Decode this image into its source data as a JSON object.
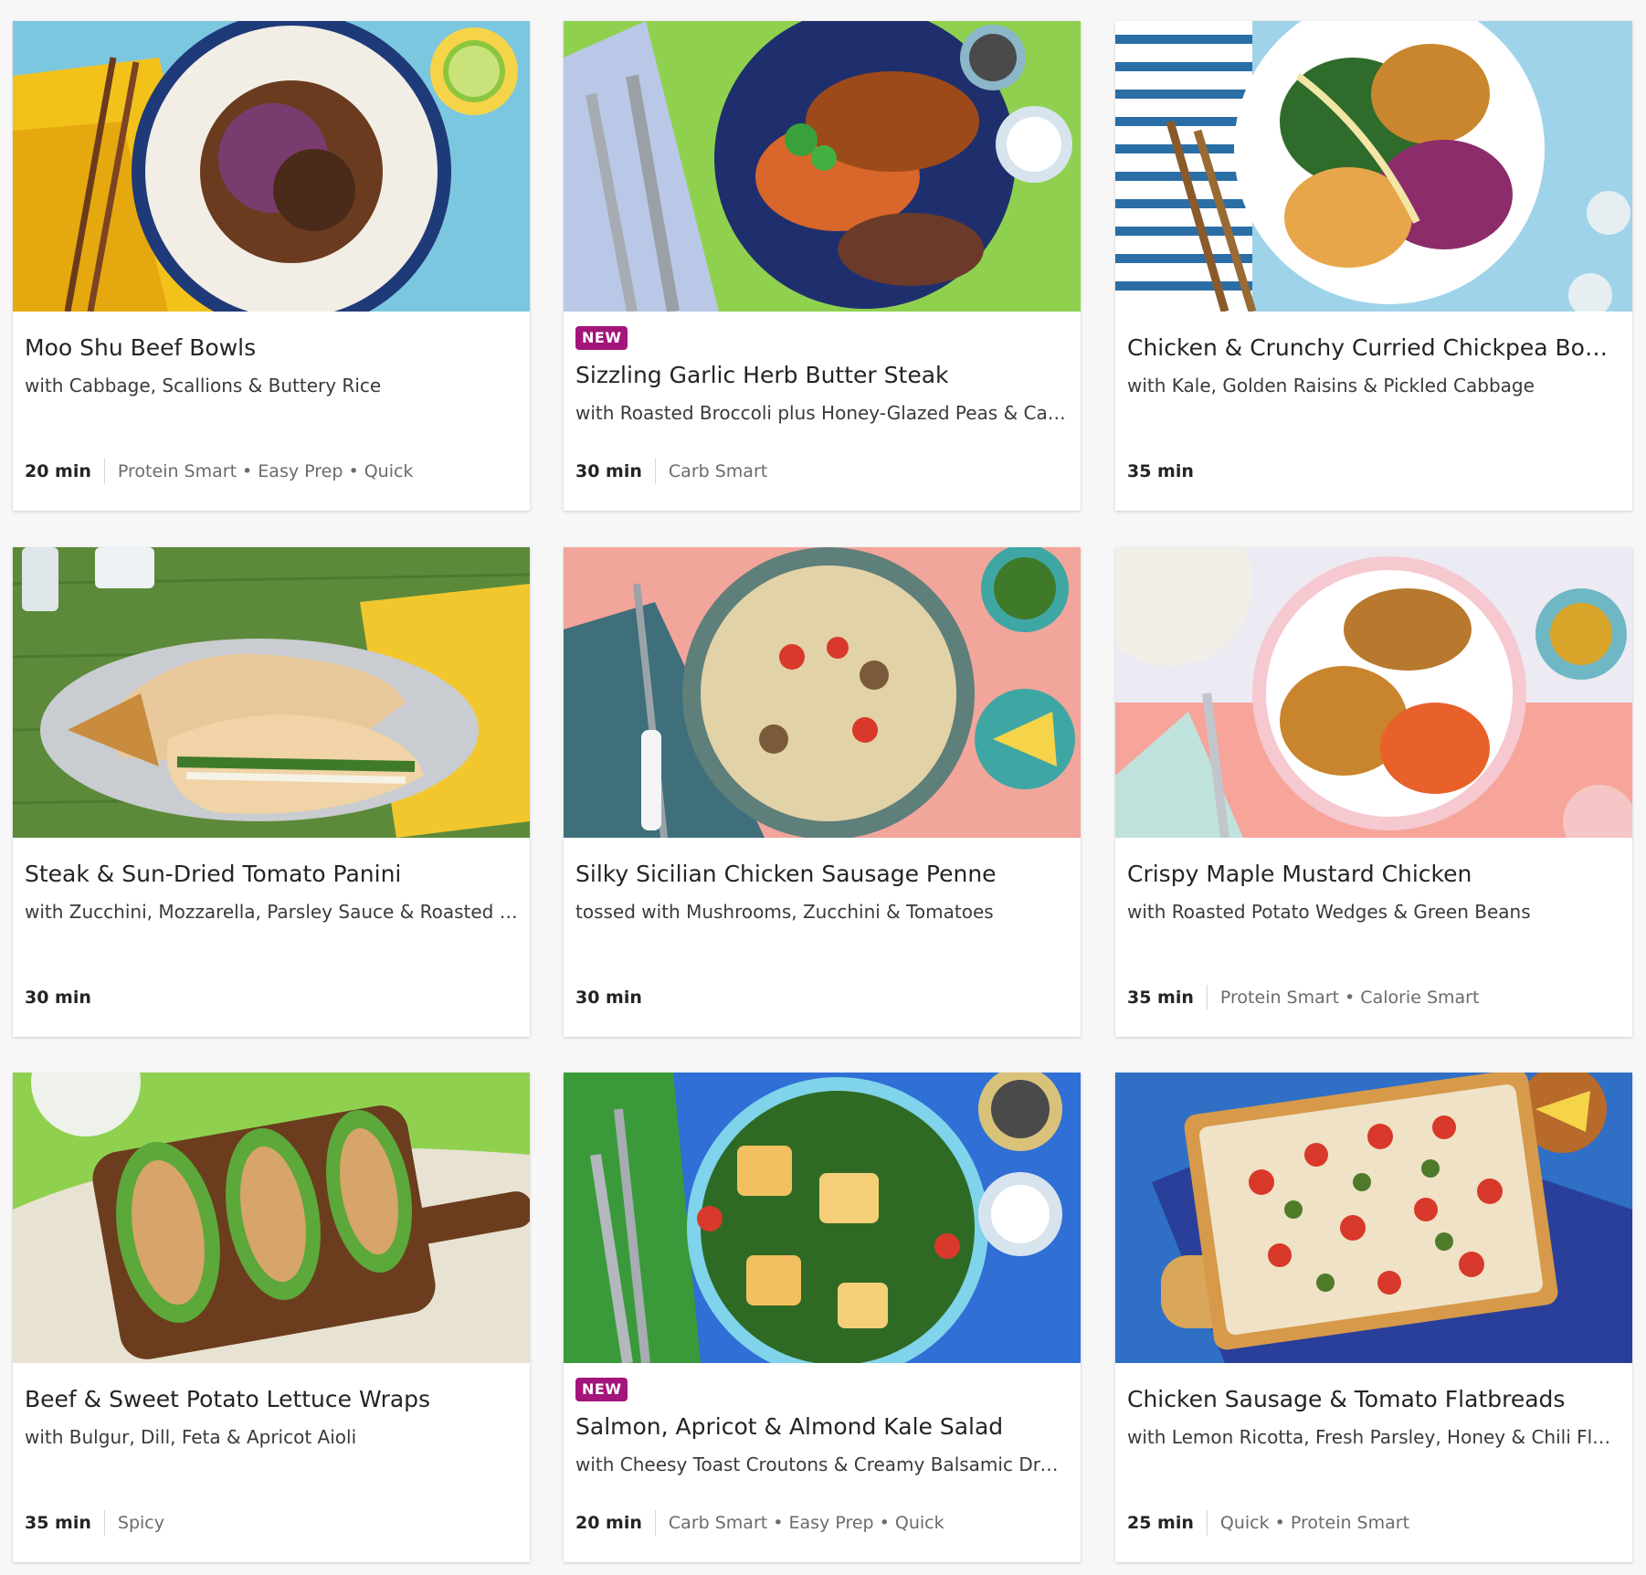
{
  "badge_label": "NEW",
  "colors": {
    "badge": "#a3157a",
    "card": "#ffffff",
    "page": "#f7f7f7"
  },
  "recipes": [
    {
      "title": "Moo Shu Beef Bowls",
      "subtitle": "with Cabbage, Scallions & Buttery Rice",
      "time": "20 min",
      "tags": "Protein Smart • Easy Prep • Quick"
    },
    {
      "title": "Sizzling Garlic Herb Butter Steak",
      "subtitle": "with Roasted Broccoli plus Honey-Glazed Peas & Carrots",
      "time": "30 min",
      "tags": "Carb Smart",
      "badge": "NEW"
    },
    {
      "title": "Chicken & Crunchy Curried Chickpea Bowls",
      "subtitle": "with Kale, Golden Raisins & Pickled Cabbage",
      "time": "35 min",
      "tags": ""
    },
    {
      "title": "Steak & Sun-Dried Tomato Panini",
      "subtitle": "with Zucchini, Mozzarella, Parsley Sauce & Roasted Potatoes",
      "time": "30 min",
      "tags": ""
    },
    {
      "title": "Silky Sicilian Chicken Sausage Penne",
      "subtitle": "tossed with Mushrooms, Zucchini & Tomatoes",
      "time": "30 min",
      "tags": ""
    },
    {
      "title": "Crispy Maple Mustard Chicken",
      "subtitle": "with Roasted Potato Wedges & Green Beans",
      "time": "35 min",
      "tags": "Protein Smart • Calorie Smart"
    },
    {
      "title": "Beef & Sweet Potato Lettuce Wraps",
      "subtitle": "with Bulgur, Dill, Feta & Apricot Aioli",
      "time": "35 min",
      "tags": "Spicy"
    },
    {
      "title": "Salmon, Apricot & Almond Kale Salad",
      "subtitle": "with Cheesy Toast Croutons & Creamy Balsamic Dressing",
      "time": "20 min",
      "tags": "Carb Smart • Easy Prep • Quick",
      "badge": "NEW"
    },
    {
      "title": "Chicken Sausage & Tomato Flatbreads",
      "subtitle": "with Lemon Ricotta, Fresh Parsley, Honey & Chili Flakes",
      "time": "25 min",
      "tags": "Quick • Protein Smart"
    }
  ]
}
